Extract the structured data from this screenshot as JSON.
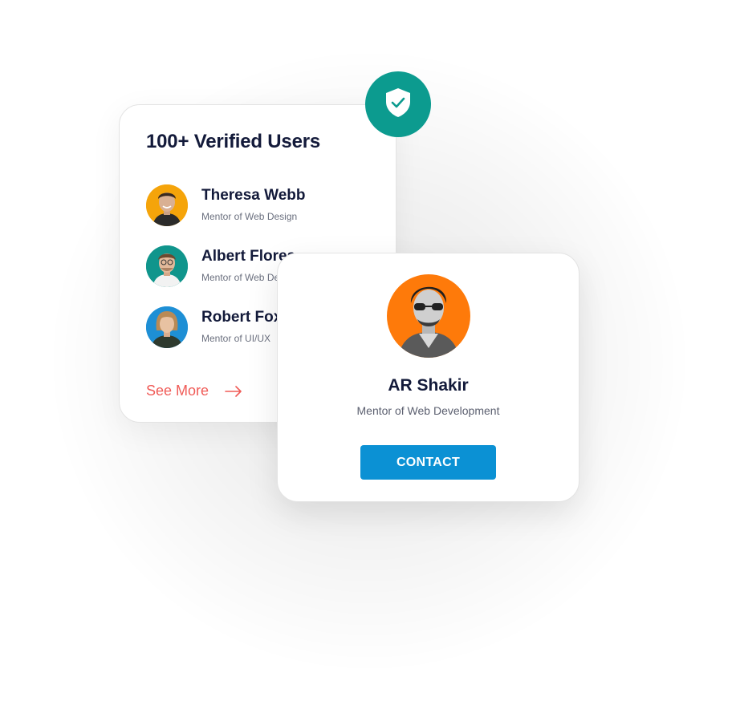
{
  "users_card": {
    "title": "100+ Verified Users",
    "users": [
      {
        "name": "Theresa Webb",
        "role": "Mentor of Web Design",
        "avatar_bg": "#f5a40a"
      },
      {
        "name": "Albert Flores",
        "role": "Mentor of Web Design",
        "avatar_bg": "#10958c"
      },
      {
        "name": "Robert Fox",
        "role": "Mentor of UI/UX",
        "avatar_bg": "#1e8fd5"
      }
    ],
    "see_more_label": "See More",
    "see_more_icon": "arrow-right-icon"
  },
  "badge": {
    "icon": "shield-check-icon",
    "color": "#0c9b8f"
  },
  "profile_card": {
    "name": "AR Shakir",
    "role": "Mentor of Web Development",
    "avatar_bg": "#fe7a0a",
    "contact_label": "CONTACT",
    "button_color": "#0b91d4"
  },
  "colors": {
    "heading": "#131a3a",
    "accent_link": "#f05b57"
  }
}
